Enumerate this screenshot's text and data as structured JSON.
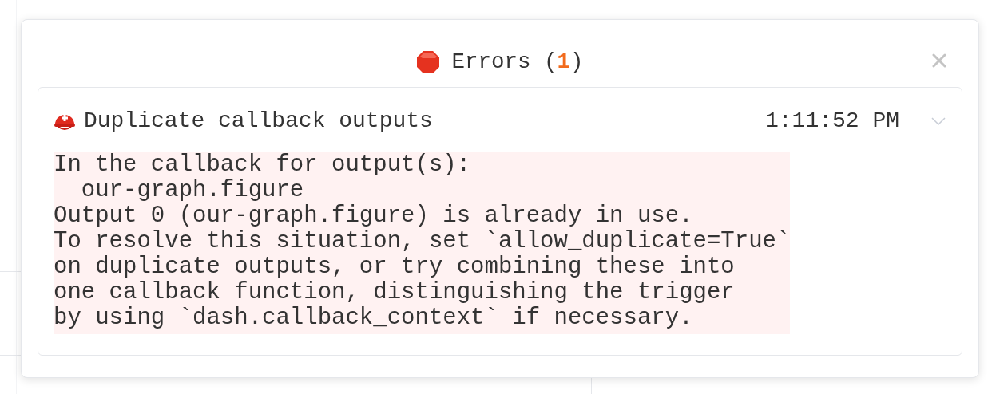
{
  "dialog": {
    "title": "Errors (**1**)"
  },
  "errors": [
    {
      "title": "Duplicate callback outputs",
      "time": "1:11:52 PM",
      "expanded": true,
      "message": "In the callback for output(s):\n  our-graph.figure\nOutput 0 (our-graph.figure) is already in use.\nTo resolve this situation, set `allow_duplicate=True`\non duplicate outputs, or try combining these into\none callback function, distinguishing the trigger\nby using `dash.callback_context` if necessary."
    }
  ]
}
